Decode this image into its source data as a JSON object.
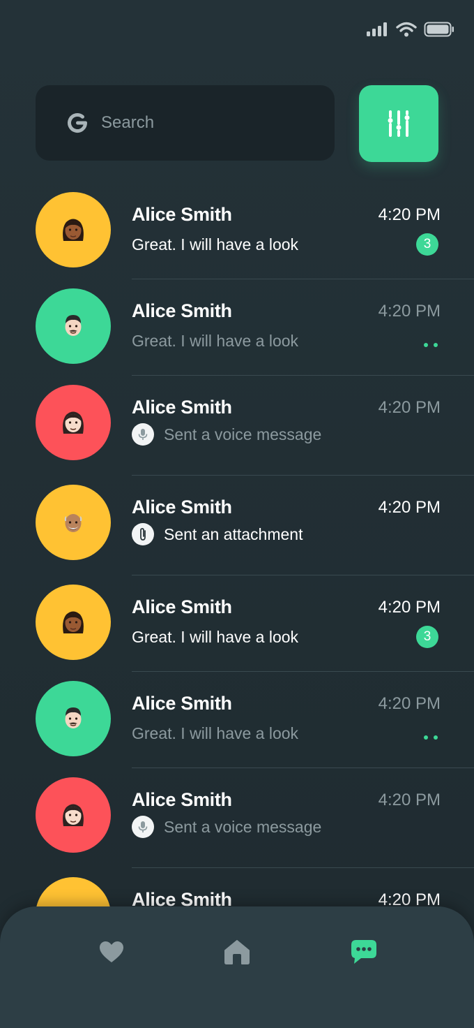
{
  "status_bar": {
    "icons": [
      "signal-icon",
      "wifi-icon",
      "battery-icon"
    ]
  },
  "search": {
    "placeholder": "Search",
    "provider_icon": "google-g-icon"
  },
  "filter_button": {
    "icon": "sliders-icon",
    "color": "#3dd897"
  },
  "chats": [
    {
      "name": "Alice Smith",
      "time": "4:20 PM",
      "preview": "Great. I will have a look",
      "preview_icon": null,
      "unread": "3",
      "typing": false,
      "read": false,
      "avatar_color": "#ffc233",
      "avatar_icon": "woman-dark-skin-emoji"
    },
    {
      "name": "Alice Smith",
      "time": "4:20 PM",
      "preview": "Great. I will have a look",
      "preview_icon": null,
      "unread": null,
      "typing": true,
      "read": true,
      "avatar_color": "#3dd897",
      "avatar_icon": "man-light-skin-emoji"
    },
    {
      "name": "Alice Smith",
      "time": "4:20 PM",
      "preview": "Sent a voice message",
      "preview_icon": "microphone-icon",
      "unread": null,
      "typing": false,
      "read": true,
      "avatar_color": "#fd5259",
      "avatar_icon": "woman-light-skin-emoji"
    },
    {
      "name": "Alice Smith",
      "time": "4:20 PM",
      "preview": "Sent an attachment",
      "preview_icon": "paperclip-icon",
      "unread": null,
      "typing": false,
      "read": false,
      "avatar_color": "#ffc233",
      "avatar_icon": "old-man-emoji"
    },
    {
      "name": "Alice Smith",
      "time": "4:20 PM",
      "preview": "Great. I will have a look",
      "preview_icon": null,
      "unread": "3",
      "typing": false,
      "read": false,
      "avatar_color": "#ffc233",
      "avatar_icon": "woman-dark-skin-emoji"
    },
    {
      "name": "Alice Smith",
      "time": "4:20 PM",
      "preview": "Great. I will have a look",
      "preview_icon": null,
      "unread": null,
      "typing": true,
      "read": true,
      "avatar_color": "#3dd897",
      "avatar_icon": "man-light-skin-emoji"
    },
    {
      "name": "Alice Smith",
      "time": "4:20 PM",
      "preview": "Sent a voice message",
      "preview_icon": "microphone-icon",
      "unread": null,
      "typing": false,
      "read": true,
      "avatar_color": "#fd5259",
      "avatar_icon": "woman-light-skin-emoji"
    },
    {
      "name": "Alice Smith",
      "time": "4:20 PM",
      "preview": "",
      "preview_icon": null,
      "unread": null,
      "typing": false,
      "read": false,
      "avatar_color": "#ffc233",
      "avatar_icon": "old-man-emoji"
    }
  ],
  "bottom_nav": [
    {
      "icon": "heart-icon",
      "active": false
    },
    {
      "icon": "home-icon",
      "active": false
    },
    {
      "icon": "chat-icon",
      "active": true
    }
  ],
  "colors": {
    "accent": "#3dd897",
    "muted_text": "#8c9a9f",
    "background": "#243238",
    "nav_background": "#2d3e45"
  }
}
